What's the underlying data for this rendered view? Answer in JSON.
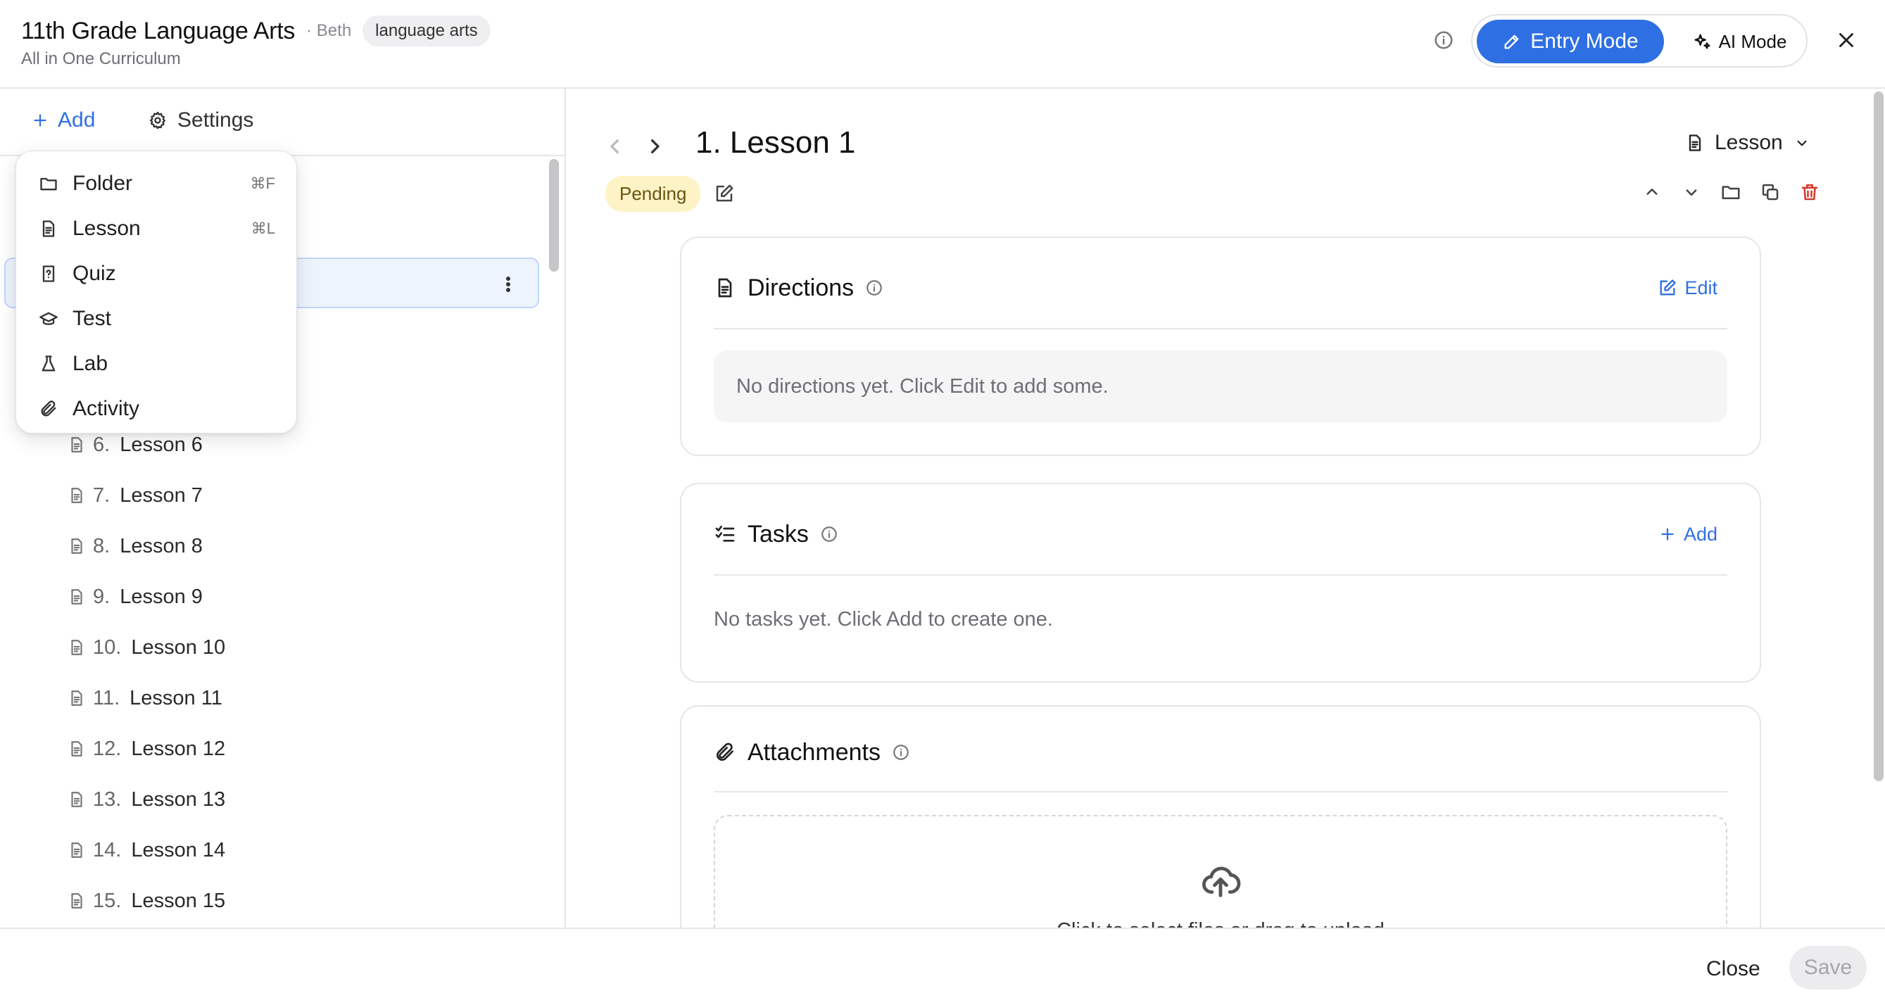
{
  "header": {
    "course_title": "11th Grade Language Arts",
    "owner": "· Beth",
    "subject_badge": "language arts",
    "subtitle": "All in One Curriculum",
    "mode_entry_label": "Entry Mode",
    "mode_ai_label": "AI Mode",
    "accent_color": "#2f6fe4"
  },
  "left_toolbar": {
    "add_label": "Add",
    "settings_label": "Settings"
  },
  "add_menu": {
    "items": [
      {
        "label": "Folder",
        "icon": "folder-icon",
        "shortcut": "⌘F"
      },
      {
        "label": "Lesson",
        "icon": "document-icon",
        "shortcut": "⌘L"
      },
      {
        "label": "Quiz",
        "icon": "quiz-icon",
        "shortcut": ""
      },
      {
        "label": "Test",
        "icon": "graduation-cap-icon",
        "shortcut": ""
      },
      {
        "label": "Lab",
        "icon": "flask-icon",
        "shortcut": ""
      },
      {
        "label": "Activity",
        "icon": "paperclip-icon",
        "shortcut": ""
      }
    ]
  },
  "tree": {
    "items": [
      {
        "num": "6.",
        "label": "Lesson 6"
      },
      {
        "num": "7.",
        "label": "Lesson 7"
      },
      {
        "num": "8.",
        "label": "Lesson 8"
      },
      {
        "num": "9.",
        "label": "Lesson 9"
      },
      {
        "num": "10.",
        "label": "Lesson 10"
      },
      {
        "num": "11.",
        "label": "Lesson 11"
      },
      {
        "num": "12.",
        "label": "Lesson 12"
      },
      {
        "num": "13.",
        "label": "Lesson 13"
      },
      {
        "num": "14.",
        "label": "Lesson 14"
      },
      {
        "num": "15.",
        "label": "Lesson 15"
      }
    ]
  },
  "main": {
    "lesson_title": "1. Lesson 1",
    "type_label": "Lesson",
    "status": "Pending",
    "directions": {
      "title": "Directions",
      "action_label": "Edit",
      "empty_text": "No directions yet. Click Edit to add some."
    },
    "tasks": {
      "title": "Tasks",
      "action_label": "Add",
      "empty_text": "No tasks yet. Click Add to create one."
    },
    "attachments": {
      "title": "Attachments",
      "upload_text": "Click to select files or drag to upload"
    }
  },
  "footer": {
    "close_label": "Close",
    "save_label": "Save"
  }
}
